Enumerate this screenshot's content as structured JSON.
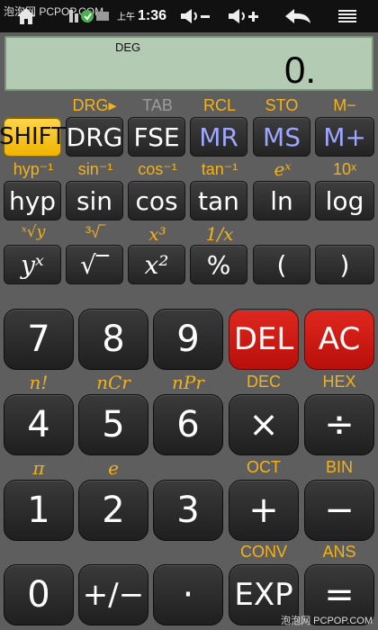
{
  "status_bar": {
    "watermark": "泡泡网 PCPOP.COM",
    "time_prefix": "上午",
    "time": "1:36",
    "icons": [
      "home-icon",
      "notification-icons",
      "volume-down-icon",
      "volume-up-icon",
      "back-icon",
      "menu-icon"
    ]
  },
  "display": {
    "mode": "DEG",
    "value": "0."
  },
  "second_labels": {
    "row1": [
      "DRG▸",
      "TAB",
      "RCL",
      "STO",
      "M−"
    ],
    "row2": [
      "hyp⁻¹",
      "sin⁻¹",
      "cos⁻¹",
      "tan⁻¹",
      "eˣ",
      "10ˣ"
    ],
    "row3": [
      "ˣ√y",
      "³√‾",
      "x³",
      "1/x"
    ],
    "row4": [
      "n!",
      "nCr",
      "nPr",
      "DEC",
      "HEX"
    ],
    "row5": [
      "π",
      "e",
      "OCT",
      "BIN"
    ],
    "row6": [
      "CONV",
      "ANS"
    ]
  },
  "keys": {
    "row1": [
      "SHIFT",
      "DRG",
      "FSE",
      "MR",
      "MS",
      "M+"
    ],
    "row2": [
      "hyp",
      "sin",
      "cos",
      "tan",
      "ln",
      "log"
    ],
    "row3": [
      "yˣ",
      "√‾",
      "x²",
      "%",
      "(",
      ")"
    ],
    "row4": [
      "7",
      "8",
      "9",
      "DEL",
      "AC"
    ],
    "row5": [
      "4",
      "5",
      "6",
      "×",
      "÷"
    ],
    "row6": [
      "1",
      "2",
      "3",
      "+",
      "−"
    ],
    "row7": [
      "0",
      "+∕−",
      "·",
      "EXP",
      "="
    ]
  },
  "footer_watermark": "泡泡网 PCPOP.COM",
  "colors": {
    "accent": "#f3b21c",
    "shift": "#f0b400",
    "danger": "#c8150f",
    "memory": "#9ea7ff",
    "display_bg": "#b3cbb3"
  }
}
